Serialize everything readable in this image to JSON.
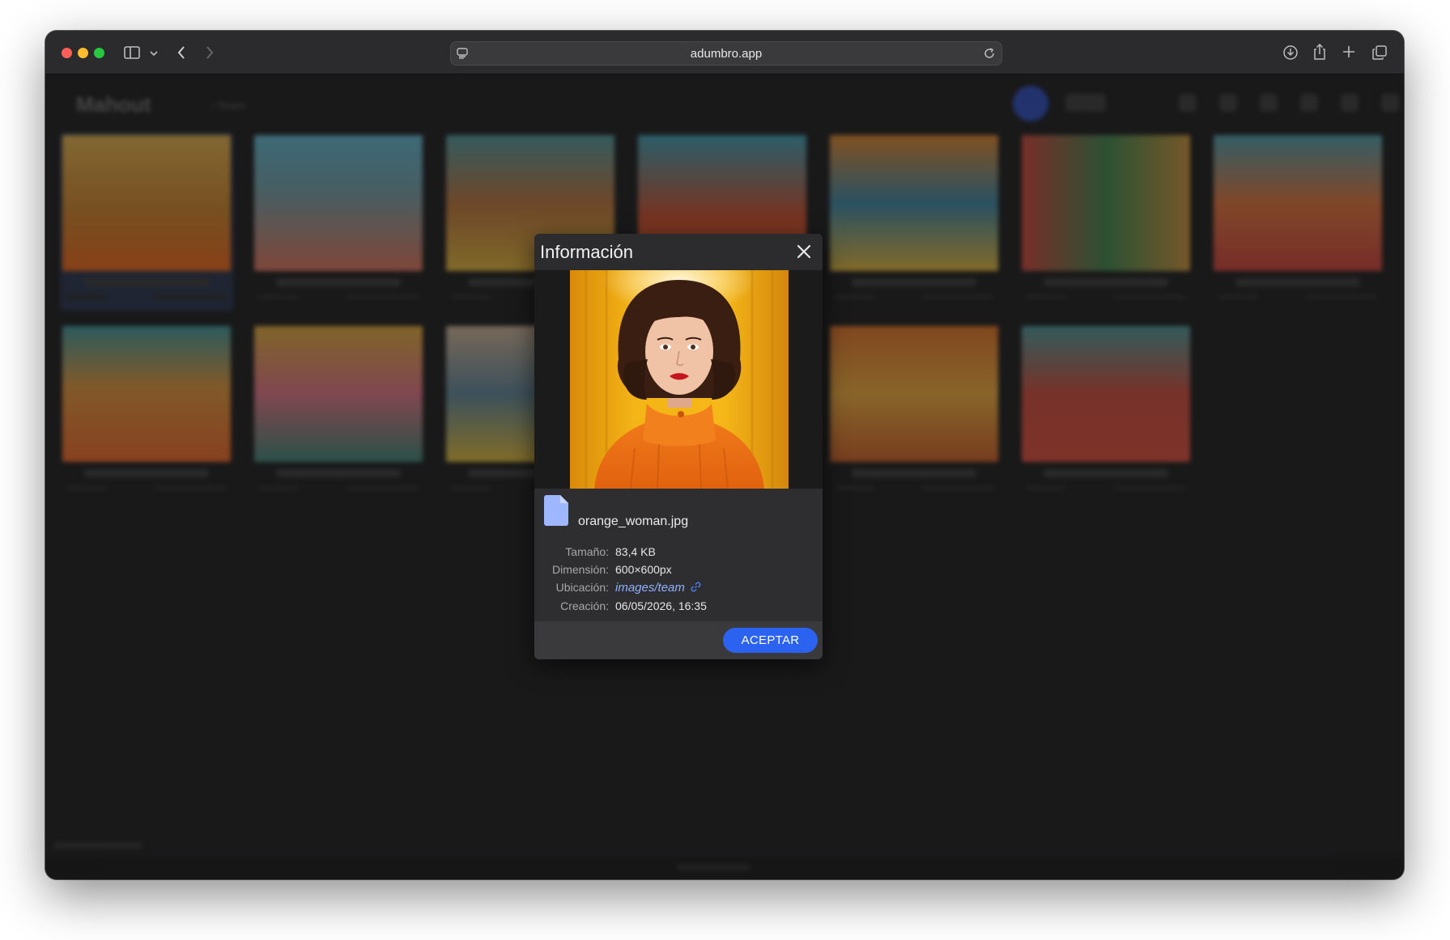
{
  "browser": {
    "url": "adumbro.app"
  },
  "app_background": {
    "logo": "Mahout",
    "breadcrumb": "/ Team"
  },
  "dialog": {
    "title": "Información",
    "file_name": "orange_woman.jpg",
    "rows": [
      {
        "label": "Tamaño:",
        "value": "83,4 KB"
      },
      {
        "label": "Dimensión:",
        "value": "600×600px"
      },
      {
        "label": "Ubicación:",
        "value": "images/team"
      },
      {
        "label": "Creación:",
        "value": "06/05/2026, 16:35"
      }
    ],
    "accept_label": "ACEPTAR"
  },
  "colors": {
    "accent": "#2b63f0",
    "link": "#8fb0ff",
    "file_icon": "#9fb7ff"
  },
  "icons": [
    "sidebar-icon",
    "chevron-down-icon",
    "back-icon",
    "forward-icon",
    "site-settings-icon",
    "reload-icon",
    "download-icon",
    "share-icon",
    "new-tab-icon",
    "tabs-overview-icon",
    "close-icon",
    "file-icon",
    "link-icon"
  ]
}
